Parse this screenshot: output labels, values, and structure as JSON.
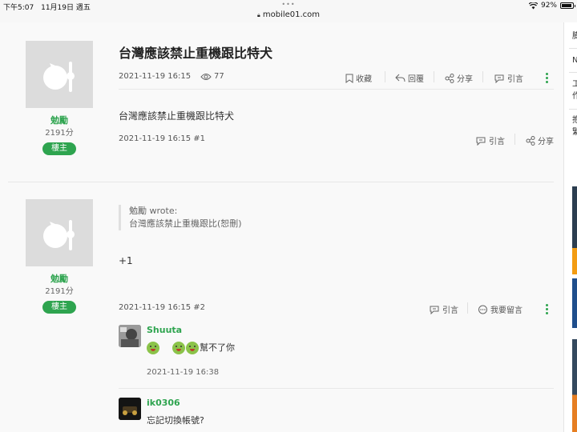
{
  "status_bar": {
    "time": "下午5:07",
    "date": "11月19日 週五",
    "url": "mobile01.com",
    "battery": "92%",
    "battery_level": 0.92
  },
  "thread": {
    "title": "台灣應該禁止重機跟比特犬",
    "date": "2021-11-19 16:15",
    "views": "77"
  },
  "actions": {
    "bookmark": "收藏",
    "reply": "回覆",
    "share": "分享",
    "quote": "引言",
    "comment": "我要留言"
  },
  "posts": [
    {
      "author": "勉勵",
      "score": "2191分",
      "badge": "樓主",
      "body": "台灣應該禁止重機跟比特犬",
      "footer": "2021-11-19 16:15 #1"
    },
    {
      "author": "勉勵",
      "score": "2191分",
      "badge": "樓主",
      "quote_author": "勉勵 wrote:",
      "quote_text": "台灣應該禁止重機跟比(恕刪)",
      "body": "+1",
      "footer": "2021-11-19 16:15 #2"
    }
  ],
  "comments": [
    {
      "user": "Shuuta",
      "text": "幫不了你",
      "time": "2021-11-19 16:38"
    },
    {
      "user": "ik0306",
      "text": "忘記切換帳號?"
    }
  ],
  "sidebar": {
    "items": [
      "膨",
      "N",
      "工",
      "作",
      "抱",
      "繁"
    ]
  },
  "icons": {
    "eye": "eye-icon",
    "bookmark": "bookmark-icon",
    "reply": "reply-icon",
    "share": "share-icon",
    "quote": "quote-icon",
    "comment": "comment-icon",
    "more": "more-vertical-icon",
    "wifi": "wifi-icon",
    "lock": "lock-icon"
  },
  "colors": {
    "accent": "#2ea44f",
    "avatar_bg": "#dcdcdc"
  }
}
